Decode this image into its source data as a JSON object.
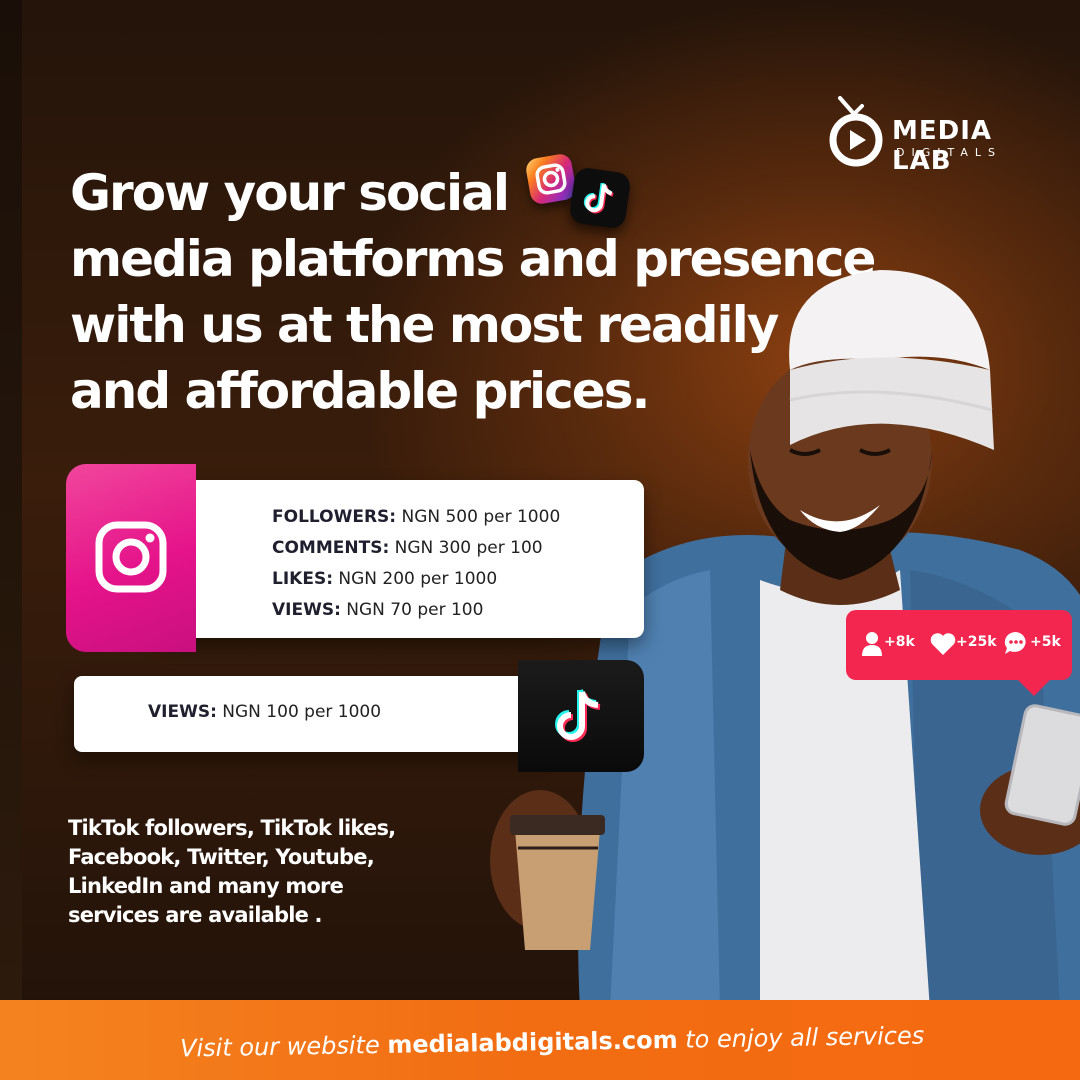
{
  "brand": {
    "name": "MEDIA LAB",
    "sub": "DIGITALS",
    "colors": {
      "accent_pink": "#e5138a",
      "notif_red": "#f2264f",
      "footer_orange": "#f26c12",
      "background_brown": "#3a1d0b"
    }
  },
  "headline": {
    "lines": [
      "Grow your social",
      "media platforms and presence",
      "with us at the most readily",
      "and affordable prices."
    ]
  },
  "instagram": {
    "icon": "instagram-icon",
    "items": [
      {
        "label": "FOLLOWERS:",
        "value": "NGN 500 per 1000"
      },
      {
        "label": "COMMENTS:",
        "value": "NGN 300 per 100"
      },
      {
        "label": "LIKES:",
        "value": "NGN 200 per 1000"
      },
      {
        "label": "VIEWS:",
        "value": "NGN 70 per 100"
      }
    ]
  },
  "tiktok": {
    "icon": "tiktok-icon",
    "items": [
      {
        "label": "VIEWS:",
        "value": "NGN 100 per 1000"
      }
    ]
  },
  "notification": {
    "followers": "+8k",
    "likes": "+25k",
    "comments": "+5k"
  },
  "services": {
    "lines": [
      "TikTok  followers, TikTok likes,",
      "Facebook, Twitter, Youtube,",
      "LinkedIn and many more",
      "services are available ."
    ]
  },
  "footer": {
    "before": "Visit our website ",
    "link": "medialabdigitals.com",
    "after": " to enjoy all services"
  }
}
